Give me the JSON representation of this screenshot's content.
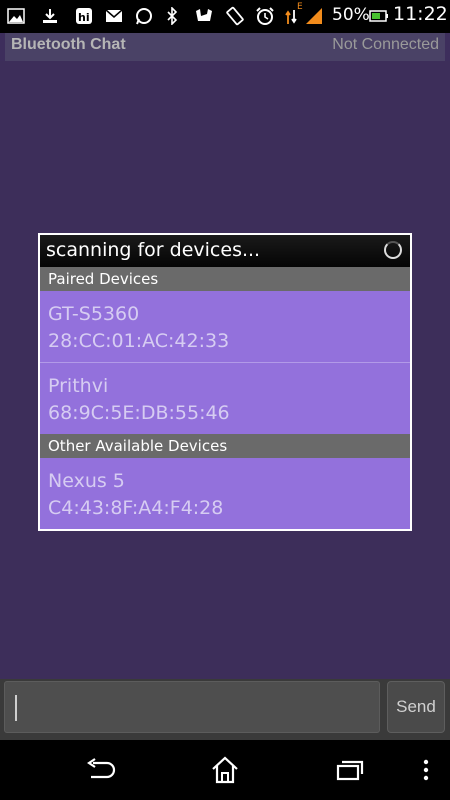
{
  "status_bar": {
    "icons": [
      "gallery-icon",
      "download-icon",
      "hike-icon",
      "gmail-icon",
      "whatsapp-icon",
      "bluetooth-icon",
      "nfc-icon",
      "rotate-icon",
      "alarm-icon",
      "mobile-data-icon",
      "signal-icon",
      "battery-icon"
    ],
    "battery_percent": "50%",
    "time": "11:22",
    "network_type": "E"
  },
  "title_bar": {
    "app_title": "Bluetooth Chat",
    "connection_status": "Not Connected"
  },
  "dialog": {
    "title": "scanning for devices...",
    "paired_section_label": "Paired Devices",
    "paired_devices": [
      {
        "name": "GT-S5360",
        "address": "28:CC:01:AC:42:33"
      },
      {
        "name": "Prithvi",
        "address": "68:9C:5E:DB:55:46"
      }
    ],
    "other_section_label": "Other Available Devices",
    "other_devices": [
      {
        "name": "Nexus 5",
        "address": "C4:43:8F:A4:F4:28"
      }
    ]
  },
  "input": {
    "value": "",
    "send_label": "Send"
  },
  "nav_bar": {
    "buttons": [
      "back-icon",
      "home-icon",
      "recent-apps-icon",
      "menu-icon"
    ]
  },
  "colors": {
    "background": "#3d2e5a",
    "device_row": "#9371dc",
    "section_header": "#6a6a6a"
  }
}
